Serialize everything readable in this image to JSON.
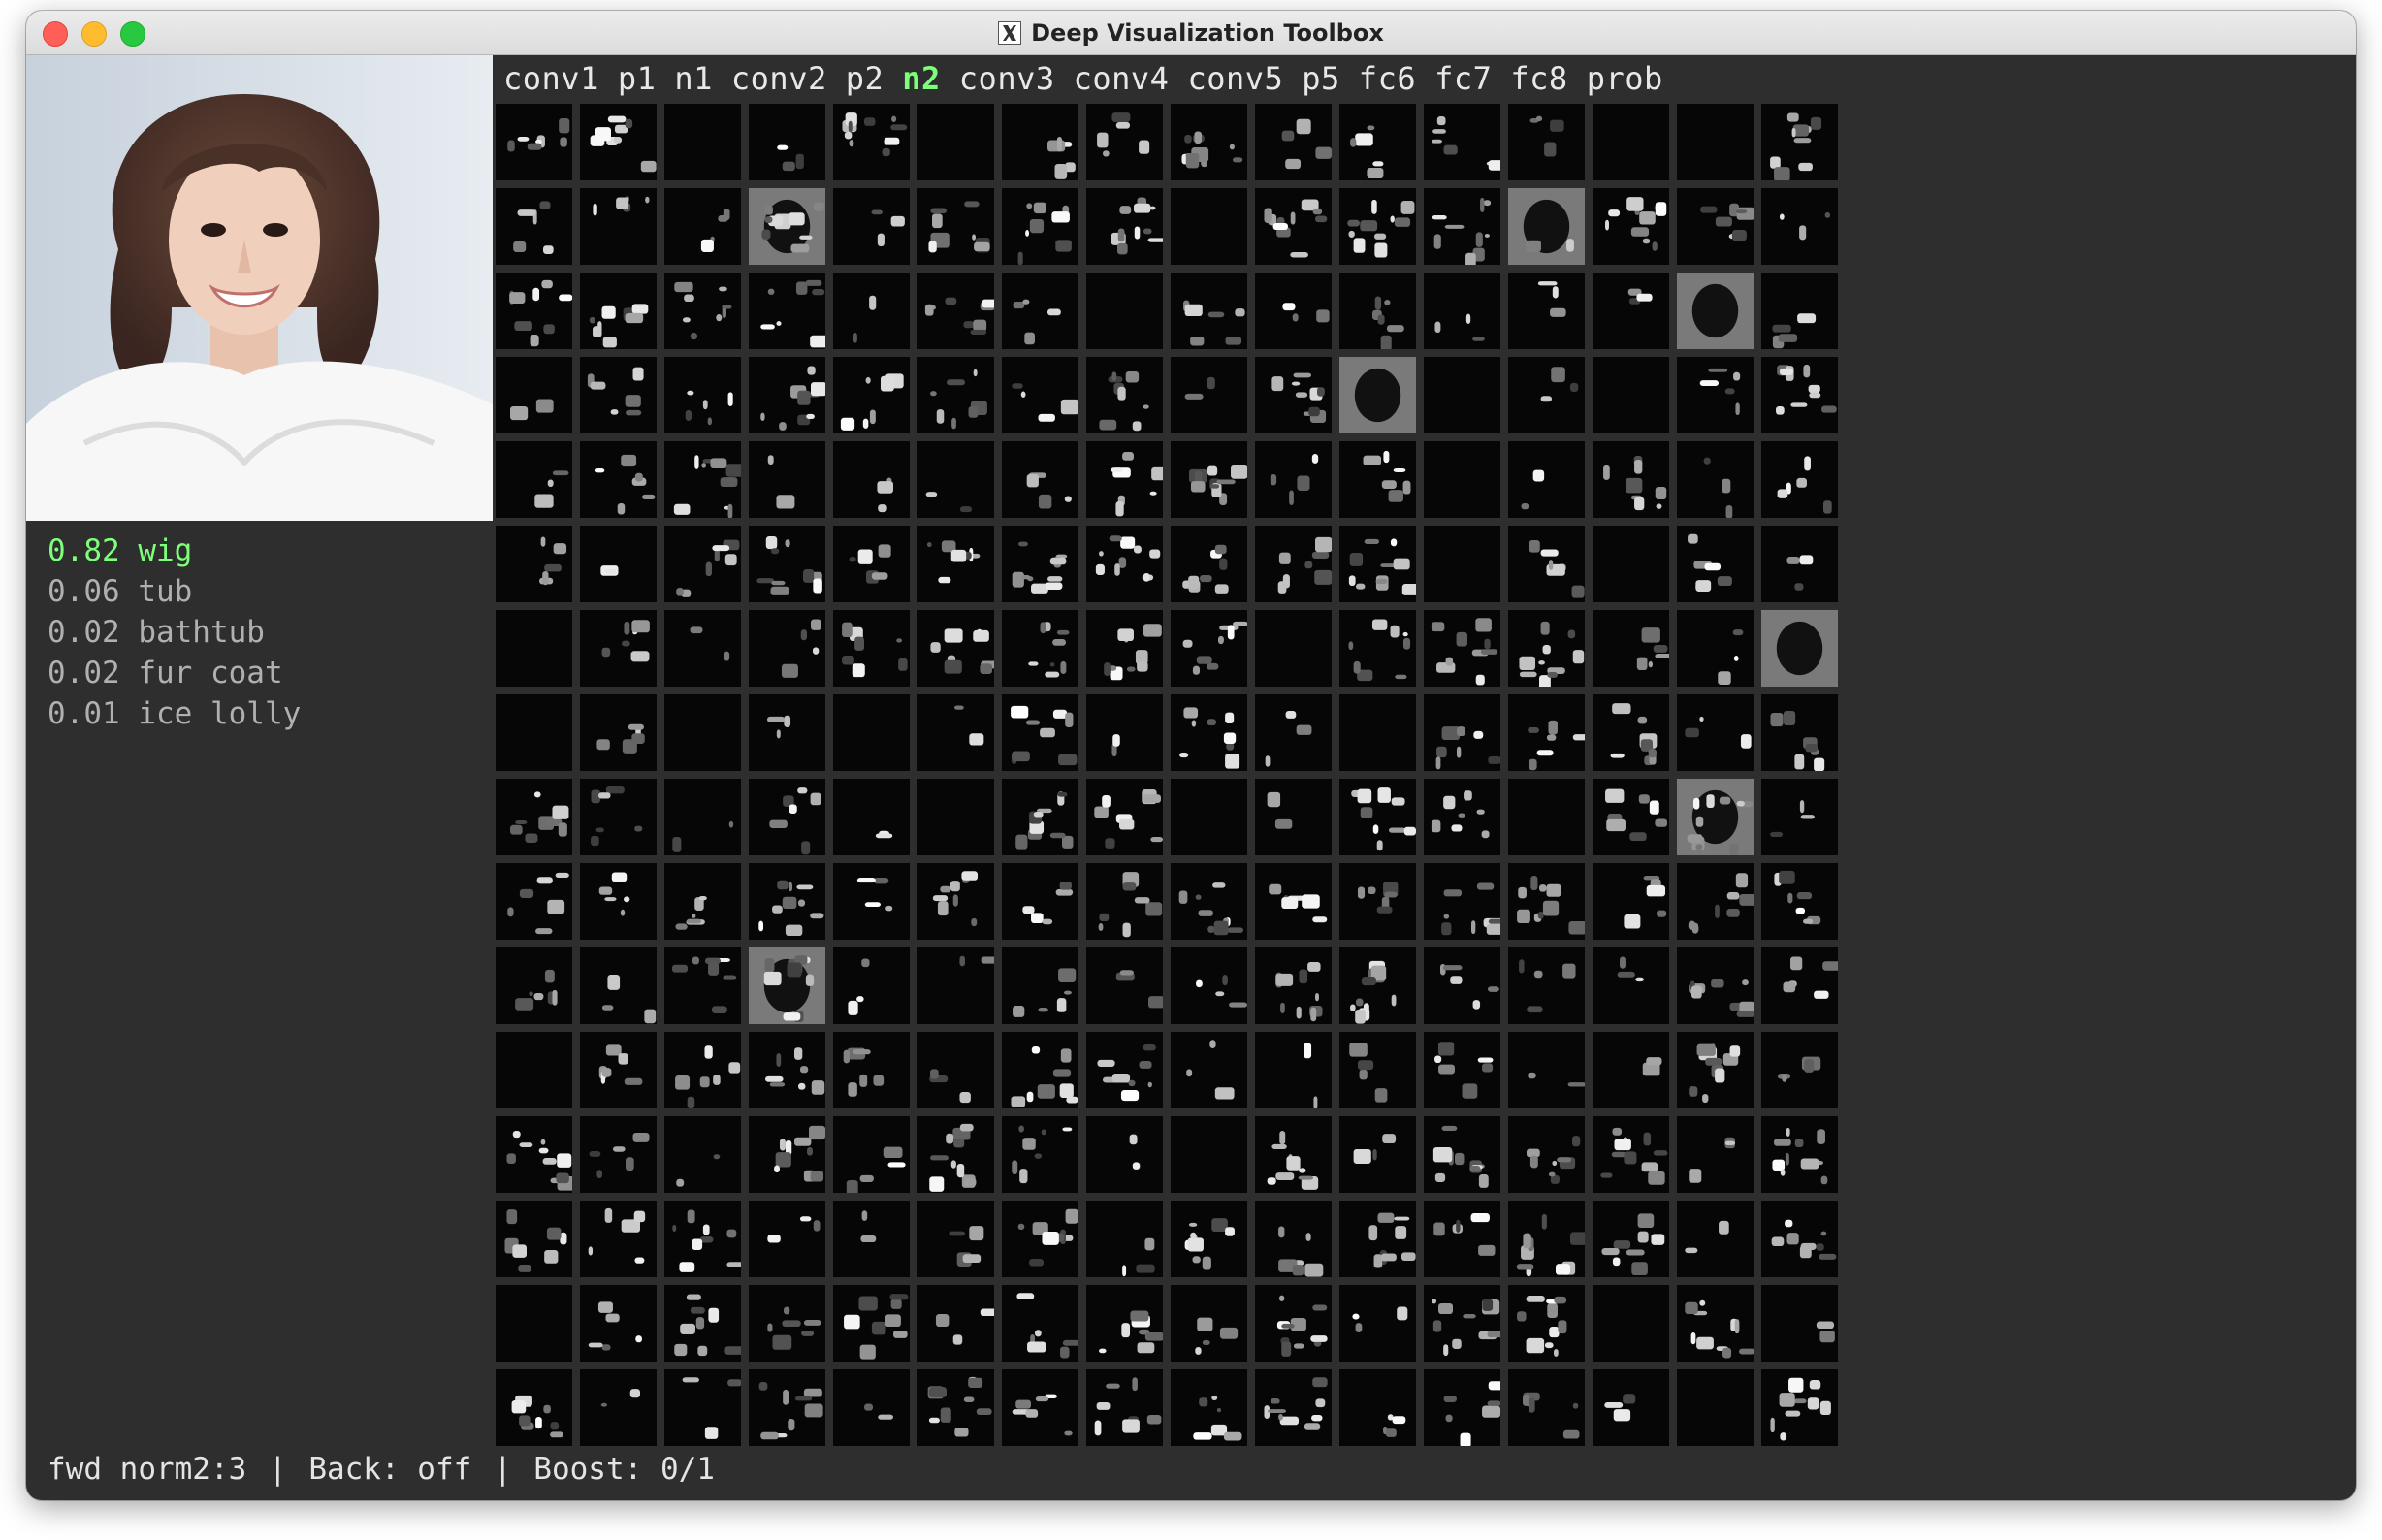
{
  "window": {
    "title": "Deep Visualization Toolbox"
  },
  "layers": {
    "tabs": [
      "conv1",
      "p1",
      "n1",
      "conv2",
      "p2",
      "n2",
      "conv3",
      "conv4",
      "conv5",
      "p5",
      "fc6",
      "fc7",
      "fc8",
      "prob"
    ],
    "active": "n2"
  },
  "predictions": [
    {
      "text": "0.82 wig"
    },
    {
      "text": "0.06 tub"
    },
    {
      "text": "0.02 bathtub"
    },
    {
      "text": "0.02 fur coat"
    },
    {
      "text": "0.01 ice lolly"
    }
  ],
  "status": {
    "mode": "fwd norm2:3",
    "back": "Back: off",
    "boost": "Boost: 0/1"
  },
  "feature_grid": {
    "rows": 16,
    "cols": 16
  },
  "colors": {
    "active_layer": "#7dff7a",
    "top_prediction": "#7dff7a",
    "other_predictions": "#b0b0b0",
    "background": "#2e2e2e"
  },
  "icons": {
    "title_icon": "x11-icon"
  }
}
